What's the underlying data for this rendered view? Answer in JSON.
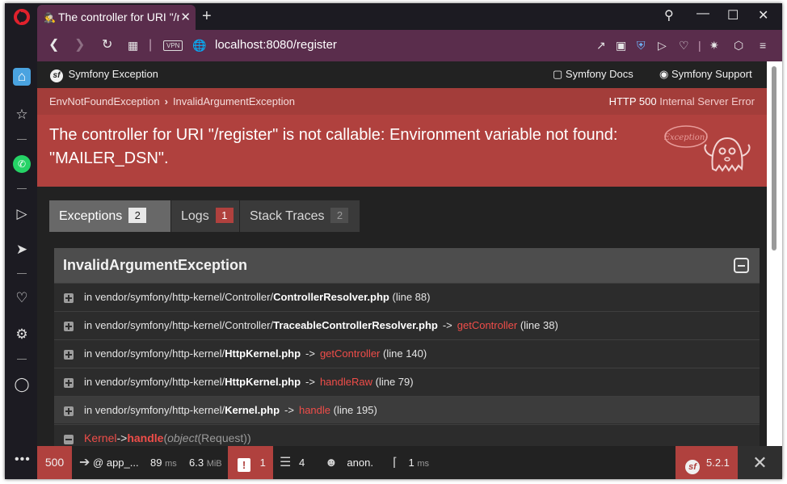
{
  "browser": {
    "tab_title": "The controller for URI \"/r",
    "tab_icon": "incognito-icon",
    "url": "localhost:8080/register",
    "vpn_label": "VPN"
  },
  "sf_header": {
    "brand": "Symfony Exception",
    "docs": "Symfony Docs",
    "support": "Symfony Support"
  },
  "summary": {
    "breadcrumb_1": "EnvNotFoundException",
    "breadcrumb_2": "InvalidArgumentException",
    "http_code": "HTTP 500",
    "http_text": "Internal Server Error",
    "message": "The controller for URI \"/register\" is not callable: Environment variable not found: \"MAILER_DSN\".",
    "ghost_label": "Exception!"
  },
  "tabs": {
    "exceptions_label": "Exceptions",
    "exceptions_count": "2",
    "logs_label": "Logs",
    "logs_count": "1",
    "traces_label": "Stack Traces",
    "traces_count": "2"
  },
  "trace": {
    "class": "InvalidArgumentException",
    "lines": [
      {
        "prefix": "in vendor/symfony/http-kernel/Controller/",
        "file": "ControllerResolver.php",
        "arrow": "",
        "func": "",
        "line": "(line 88)"
      },
      {
        "prefix": "in vendor/symfony/http-kernel/Controller/",
        "file": "TraceableControllerResolver.php",
        "arrow": "->",
        "func": "getController",
        "line": "(line 38)"
      },
      {
        "prefix": "in vendor/symfony/http-kernel/",
        "file": "HttpKernel.php",
        "arrow": "->",
        "func": "getController",
        "line": "(line 140)"
      },
      {
        "prefix": "in vendor/symfony/http-kernel/",
        "file": "HttpKernel.php",
        "arrow": "->",
        "func": "handleRaw",
        "line": "(line 79)"
      },
      {
        "prefix": "in vendor/symfony/http-kernel/",
        "file": "Kernel.php",
        "arrow": "->",
        "func": "handle",
        "line": "(line 195)"
      }
    ],
    "code_line": {
      "cls": "Kernel",
      "arrow": "->",
      "fn": "handle",
      "arg_open": "(",
      "arg": "object",
      "argtype": "(Request)",
      "arg_close": ")"
    }
  },
  "profiler": {
    "status": "500",
    "route": "@ app_...",
    "time_value": "89",
    "time_unit": "ms",
    "memory_value": "6.3",
    "memory_unit": "MiB",
    "errors": "1",
    "layers": "4",
    "user": "anon.",
    "ajax_value": "1",
    "ajax_unit": "ms",
    "version": "5.2.1"
  },
  "colors": {
    "accent": "#b0413e",
    "browser_chrome": "#5a2d4c"
  }
}
